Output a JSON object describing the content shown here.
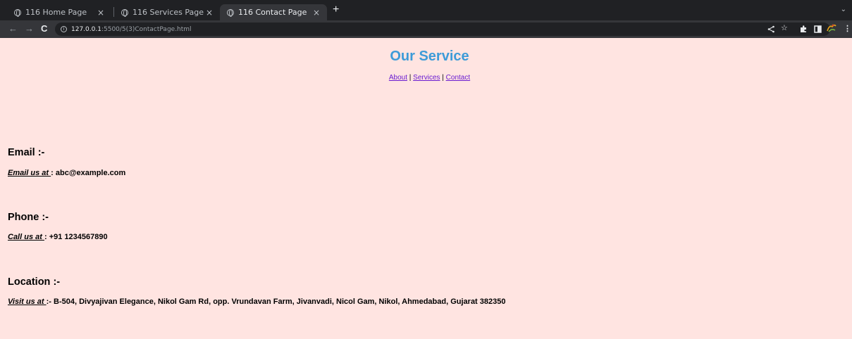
{
  "browser": {
    "tabs": [
      {
        "title": "116 Home Page",
        "close": "×"
      },
      {
        "title": "116 Services Page",
        "close": "×"
      },
      {
        "title": "116 Contact Page",
        "close": "×"
      }
    ],
    "new_tab": "+",
    "tab_menu": "⌄",
    "nav": {
      "back": "←",
      "forward": "→",
      "reload": "C"
    },
    "url_host": "127.0.0.1",
    "url_path": ":5500/5(3)ContactPage.html"
  },
  "page": {
    "title": "Our Service",
    "nav_links": [
      "About",
      "Services",
      "Contact"
    ],
    "separator": " | ",
    "sections": [
      {
        "heading": "Email :-",
        "label": "Email us at ",
        "sep": ": ",
        "value": "abc@example.com"
      },
      {
        "heading": "Phone :-",
        "label": "Call us at ",
        "sep": ": ",
        "value": "+91 1234567890"
      },
      {
        "heading": "Location :-",
        "label": "Visit us at ",
        "sep": ":- ",
        "value": "B-504, Divyajivan Elegance, Nikol Gam Rd, opp. Vrundavan Farm, Jivanvadi, Nicol Gam, Nikol, Ahmedabad, Gujarat 382350"
      }
    ]
  },
  "colors": {
    "background": "#ffe4e1",
    "title": "#3d9bd8",
    "link": "#6a1bd1"
  }
}
